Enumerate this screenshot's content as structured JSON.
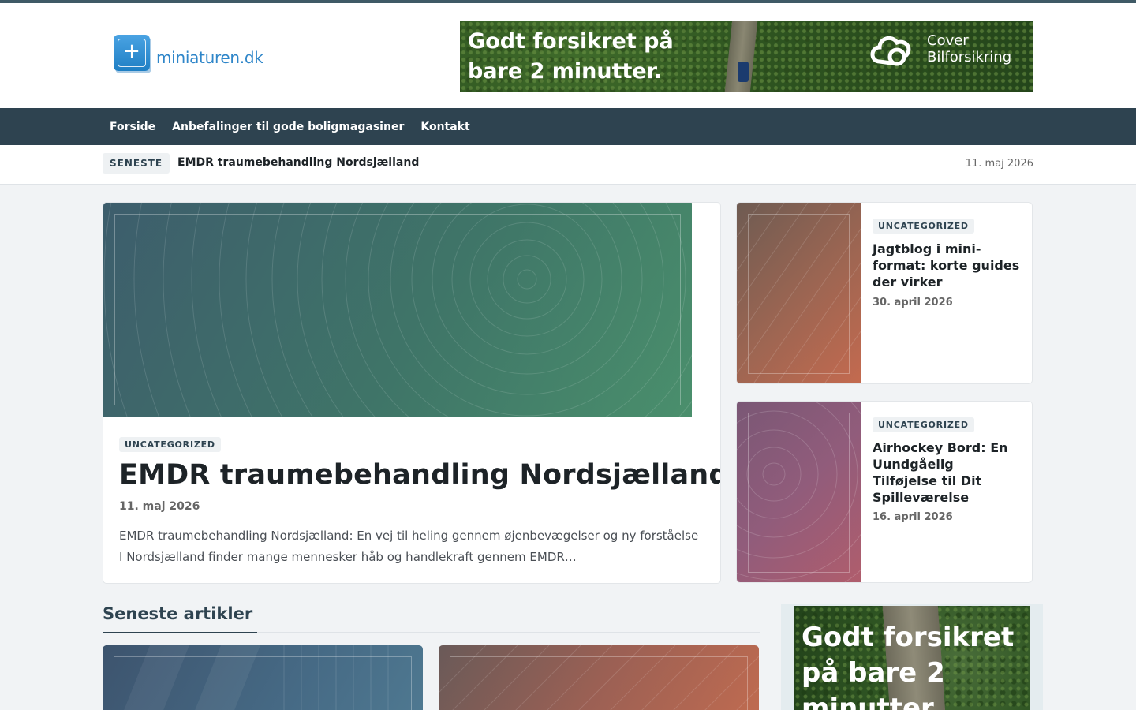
{
  "site": {
    "logo_text": "miniaturen.dk"
  },
  "ad_top": {
    "headline_line1": "Godt forsikret på",
    "headline_line2": "bare 2 minutter.",
    "brand_line1": "Cover",
    "brand_line2": "Bilforsikring"
  },
  "nav": {
    "items": [
      "Forside",
      "Anbefalinger til gode boligmagasiner",
      "Kontakt"
    ]
  },
  "ticker": {
    "badge": "SENESTE",
    "headline": "EMDR traumebehandling Nordsjælland",
    "date": "11. maj 2026"
  },
  "hero": {
    "category": "UNCATEGORIZED",
    "title": "EMDR traumebehandling Nordsjælland",
    "date": "11. maj 2026",
    "excerpt": "EMDR traumebehandling Nordsjælland: En vej til heling gennem øjenbevægelser og ny forståelse I Nordsjælland finder mange mennesker håb og handlekraft gennem EMDR…"
  },
  "side_posts": [
    {
      "category": "UNCATEGORIZED",
      "title": "Jagtblog i mini-format: korte guides der virker",
      "date": "30. april 2026"
    },
    {
      "category": "UNCATEGORIZED",
      "title": "Airhockey Bord: En Uundgåelig Tilføjelse til Dit Spilleværelse",
      "date": "16. april 2026"
    }
  ],
  "latest": {
    "section_title": "Seneste artikler"
  },
  "ad_side": {
    "headline_line1": "Godt forsikret",
    "headline_line2": "på bare 2",
    "headline_line3": "minutter."
  },
  "colors": {
    "nav_bg": "#2e4350",
    "accent": "#2f86c9",
    "page_bg": "#f1f3f5"
  }
}
